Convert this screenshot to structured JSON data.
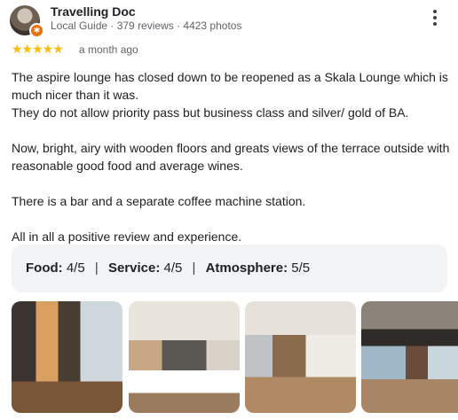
{
  "reviewer": {
    "name": "Travelling Doc",
    "meta": "Local Guide · 379 reviews · 4423 photos",
    "badge_icon": "local-guide-icon"
  },
  "rating": {
    "stars_text": "★★★★★",
    "stars_value": 5,
    "stars_color": "#fbbc04",
    "time_ago": "a month ago"
  },
  "review": {
    "paragraphs": [
      "The aspire lounge has closed down to be reopened as a Skala Lounge which is much nicer than it was.\nThey do not allow priority pass but business class and silver/ gold of BA.",
      "Now, bright, airy with wooden floors and greats views of the terrace outside with reasonable good food and average wines.",
      "There is a bar and a separate coffee machine station.",
      "All in all a positive review and experience."
    ]
  },
  "subratings": {
    "food_label": "Food:",
    "food_value": "4/5",
    "service_label": "Service:",
    "service_value": "4/5",
    "atmosphere_label": "Atmosphere:",
    "atmosphere_value": "5/5",
    "separator": "|"
  },
  "menu": {
    "icon": "more-vert-icon"
  },
  "photos": {
    "count_visible": 4
  }
}
